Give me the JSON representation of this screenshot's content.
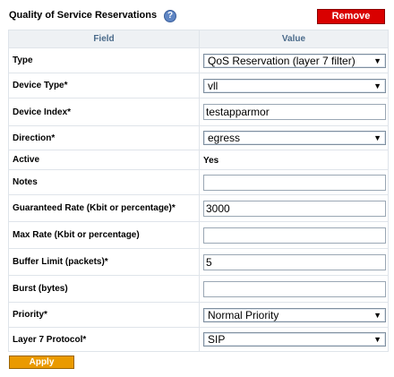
{
  "header": {
    "title": "Quality of Service Reservations",
    "help_glyph": "?",
    "remove_label": "Remove"
  },
  "table": {
    "col_field": "Field",
    "col_value": "Value"
  },
  "rows": {
    "type": {
      "label": "Type",
      "value": "QoS Reservation (layer 7 filter)"
    },
    "device_type": {
      "label": "Device Type*",
      "value": "vll"
    },
    "device_index": {
      "label": "Device Index*",
      "value": "testapparmor"
    },
    "direction": {
      "label": "Direction*",
      "value": "egress"
    },
    "active": {
      "label": "Active",
      "value": "Yes"
    },
    "notes": {
      "label": "Notes",
      "value": ""
    },
    "guaranteed_rate": {
      "label": "Guaranteed Rate (Kbit or percentage)*",
      "value": "3000"
    },
    "max_rate": {
      "label": "Max Rate (Kbit or percentage)",
      "value": ""
    },
    "buffer_limit": {
      "label": "Buffer Limit (packets)*",
      "value": "5"
    },
    "burst": {
      "label": "Burst (bytes)",
      "value": ""
    },
    "priority": {
      "label": "Priority*",
      "value": "Normal Priority"
    },
    "l7_protocol": {
      "label": "Layer 7 Protocol*",
      "value": "SIP"
    }
  },
  "footer": {
    "apply_label": "Apply"
  },
  "colors": {
    "remove": "#d90000",
    "apply": "#ea9a00",
    "header_bg": "#eef1f4"
  },
  "icons": {
    "help": "help-icon",
    "dropdown": "chevron-down-icon"
  }
}
